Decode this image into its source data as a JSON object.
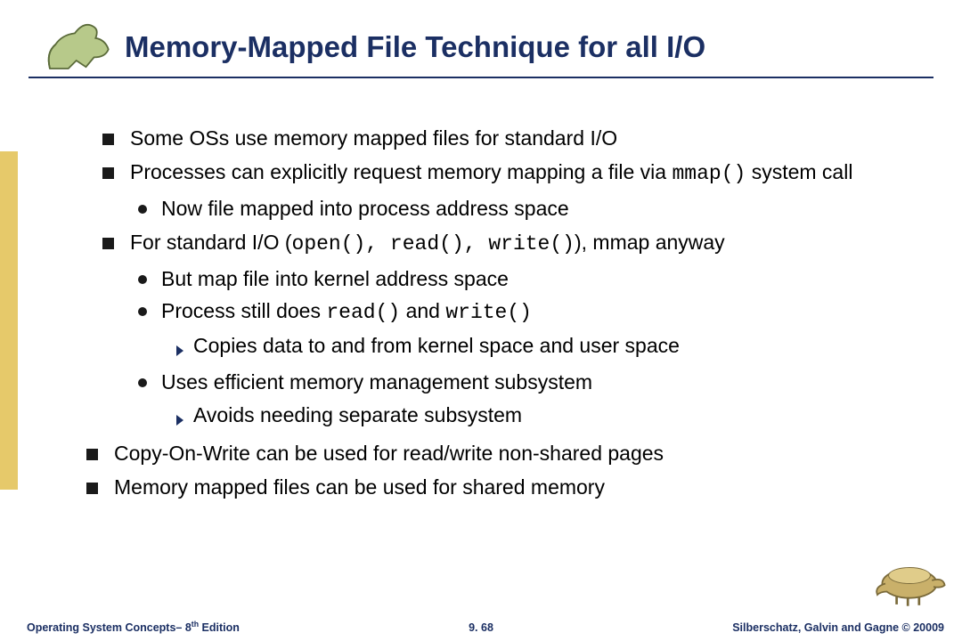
{
  "title": "Memory-Mapped File Technique for all I/O",
  "bullets": {
    "b1": "Some OSs  use memory mapped files for standard I/O",
    "b2_pre": "Processes can explicitly request memory mapping a file via ",
    "b2_code": "mmap()",
    "b2_post": " system call",
    "b2a": "Now file mapped into process address space",
    "b3_pre": "For standard I/O (",
    "b3_code": "open(), read(), write()",
    "b3_post": "), mmap anyway",
    "b3a": "But map file into kernel address space",
    "b3b_pre": "Process still does ",
    "b3b_code1": "read()",
    "b3b_mid": " and ",
    "b3b_code2": "write()",
    "b3b1": "Copies data to and from kernel space and user space",
    "b3c": "Uses efficient memory management subsystem",
    "b3c1": "Avoids needing separate subsystem",
    "b4": "Copy-On-Write can be used for read/write non-shared pages",
    "b5": "Memory mapped files can be used for shared memory"
  },
  "footer": {
    "left_pre": "Operating System Concepts– 8",
    "left_sup": "th",
    "left_post": " Edition",
    "center": "9. 68",
    "right": "Silberschatz, Galvin and Gagne © 20009"
  }
}
